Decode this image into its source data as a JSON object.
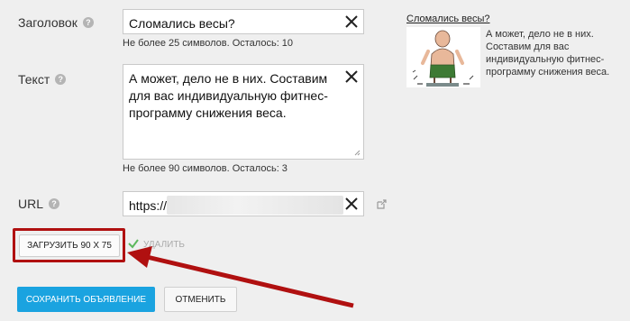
{
  "title_field": {
    "label": "Заголовок",
    "value": "Сломались весы?",
    "hint": "Не более 25 символов. Осталось: 10"
  },
  "text_field": {
    "label": "Текст",
    "value": "А может, дело не в них. Составим для вас индивидуальную фитнес-программу снижения веса.",
    "hint": "Не более 90 символов. Осталось: 3"
  },
  "url_field": {
    "label": "URL",
    "value_prefix": "https://"
  },
  "image": {
    "upload_label": "ЗАГРУЗИТЬ 90 X 75",
    "delete_label": "УДАЛИТЬ"
  },
  "actions": {
    "save_label": "СОХРАНИТЬ ОБЪЯВЛЕНИЕ",
    "cancel_label": "ОТМЕНИТЬ"
  },
  "preview": {
    "title": "Сломались весы?",
    "text": "А может, дело не в них. Составим для вас индивидуальную фитнес-программу снижения веса."
  },
  "colors": {
    "accent": "#1aa3e0",
    "annotation": "#b01010",
    "check": "#5cb85c"
  }
}
